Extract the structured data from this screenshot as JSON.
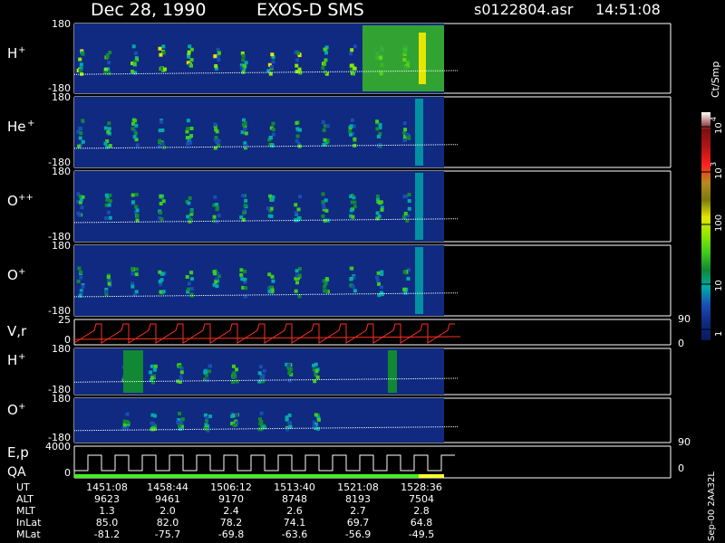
{
  "header": {
    "date": "Dec 28, 1990",
    "mission": "EXOS-D SMS",
    "file": "s0122804.asr",
    "time": "14:51:08"
  },
  "colors": {
    "background": "#000000",
    "panel_fill": "#0f2a80",
    "trace": "#ffffff",
    "vel_trace": "#ff3020",
    "qa_bar": "#44ee22",
    "qa_bar_end": "#ffff33"
  },
  "colorbar": {
    "unit": "Ct/Smp",
    "ticks": [
      "1",
      "10",
      "100",
      "10",
      "10"
    ],
    "tick_exponents": [
      "",
      "",
      "",
      "3",
      "4"
    ],
    "stops": [
      "#ffffff",
      "#7a1010",
      "#b31515",
      "#ff2020",
      "#b88a20",
      "#7a7a10",
      "#e6e600",
      "#8fe600",
      "#3fcc1a",
      "#118833",
      "#00aaaa",
      "#1a4db3",
      "#0f2a80",
      "#0a1a60"
    ]
  },
  "side_ticks": [
    "90",
    "0",
    "90",
    "0"
  ],
  "footer_note": "Sep-00  2AA32L",
  "chart_data": {
    "type": "heatmap",
    "panels": [
      {
        "species": "H",
        "charge": "+",
        "ymax": "180",
        "ymin": "-180"
      },
      {
        "species": "He",
        "charge": "+",
        "ymax": "180",
        "ymin": "-180"
      },
      {
        "species": "O",
        "charge": "++",
        "ymax": "180",
        "ymin": "-180"
      },
      {
        "species": "O",
        "charge": "+",
        "ymax": "180",
        "ymin": "-180"
      },
      {
        "species": "V,r",
        "charge": "",
        "ymax": "25",
        "ymin": "0"
      },
      {
        "species": "H",
        "charge": "+",
        "ymax": "180",
        "ymin": "-180"
      },
      {
        "species": "O",
        "charge": "+",
        "ymax": "180",
        "ymin": "-180"
      },
      {
        "species": "E,p",
        "charge": "",
        "ymax": "4000",
        "ymin": "0",
        "extra_label": "QA"
      }
    ],
    "orbit_table": {
      "rows": [
        {
          "name": "UT",
          "values": [
            "1451:08",
            "1458:44",
            "1506:12",
            "1513:40",
            "1521:08",
            "1528:36"
          ]
        },
        {
          "name": "ALT",
          "values": [
            "9623",
            "9461",
            "9170",
            "8748",
            "8193",
            "7504"
          ]
        },
        {
          "name": "MLT",
          "values": [
            "1.3",
            "2.0",
            "2.4",
            "2.6",
            "2.7",
            "2.8"
          ]
        },
        {
          "name": "InLat",
          "values": [
            "85.0",
            "82.0",
            "78.2",
            "74.1",
            "69.7",
            "64.8"
          ]
        },
        {
          "name": "MLat",
          "values": [
            "-81.2",
            "-75.7",
            "-69.8",
            "-63.6",
            "-56.9",
            "-49.5"
          ]
        }
      ]
    }
  }
}
